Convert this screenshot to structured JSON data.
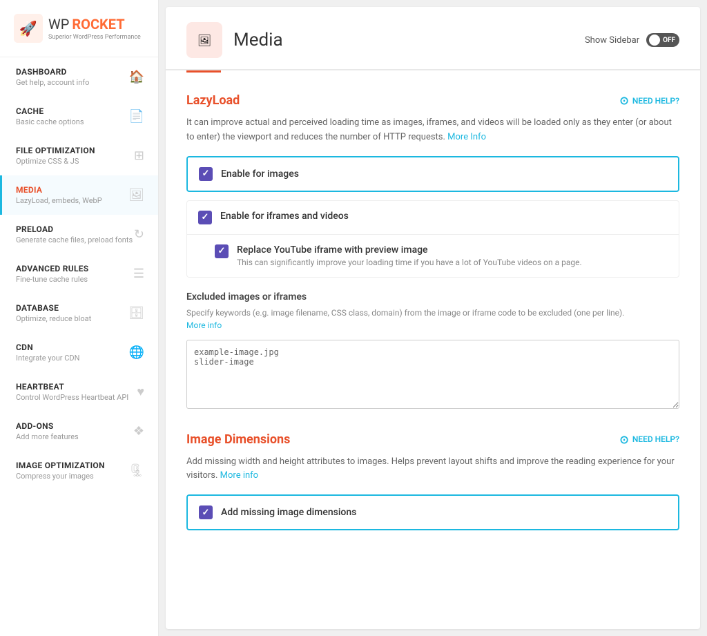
{
  "logo": {
    "wp": "WP",
    "rocket": "ROCKET",
    "subtitle": "Superior WordPress Performance"
  },
  "nav": {
    "items": [
      {
        "id": "dashboard",
        "title": "DASHBOARD",
        "subtitle": "Get help, account info",
        "icon": "🏠",
        "active": false
      },
      {
        "id": "cache",
        "title": "CACHE",
        "subtitle": "Basic cache options",
        "icon": "📄",
        "active": false
      },
      {
        "id": "file-optimization",
        "title": "FILE OPTIMIZATION",
        "subtitle": "Optimize CSS & JS",
        "icon": "⊞",
        "active": false
      },
      {
        "id": "media",
        "title": "MEDIA",
        "subtitle": "LazyLoad, embeds, WebP",
        "icon": "🖼",
        "active": true
      },
      {
        "id": "preload",
        "title": "PRELOAD",
        "subtitle": "Generate cache files, preload fonts",
        "icon": "↻",
        "active": false
      },
      {
        "id": "advanced-rules",
        "title": "ADVANCED RULES",
        "subtitle": "Fine-tune cache rules",
        "icon": "☰",
        "active": false
      },
      {
        "id": "database",
        "title": "DATABASE",
        "subtitle": "Optimize, reduce bloat",
        "icon": "🗄",
        "active": false
      },
      {
        "id": "cdn",
        "title": "CDN",
        "subtitle": "Integrate your CDN",
        "icon": "🌐",
        "active": false
      },
      {
        "id": "heartbeat",
        "title": "HEARTBEAT",
        "subtitle": "Control WordPress Heartbeat API",
        "icon": "♥",
        "active": false
      },
      {
        "id": "add-ons",
        "title": "ADD-ONS",
        "subtitle": "Add more features",
        "icon": "❖",
        "active": false
      },
      {
        "id": "image-optimization",
        "title": "IMAGE OPTIMIZATION",
        "subtitle": "Compress your images",
        "icon": "🗜",
        "active": false
      }
    ]
  },
  "page": {
    "title": "Media",
    "show_sidebar_label": "Show Sidebar",
    "toggle_label": "OFF"
  },
  "lazyload": {
    "section_title": "LazyLoad",
    "need_help": "NEED HELP?",
    "description": "It can improve actual and perceived loading time as images, iframes, and videos will be loaded only as they enter (or about to enter) the viewport and reduces the number of HTTP requests.",
    "more_info_link": "More Info",
    "enable_images_label": "Enable for images",
    "enable_iframes_label": "Enable for iframes and videos",
    "replace_youtube_label": "Replace YouTube iframe with preview image",
    "replace_youtube_sub": "This can significantly improve your loading time if you have a lot of YouTube videos on a page.",
    "excluded_title": "Excluded images or iframes",
    "excluded_desc": "Specify keywords (e.g. image filename, CSS class, domain) from the image or iframe code to be excluded (one per line).",
    "excluded_more_info": "More info",
    "excluded_placeholder": "example-image.jpg\nslider-image"
  },
  "image_dimensions": {
    "section_title": "Image Dimensions",
    "need_help": "NEED HELP?",
    "description": "Add missing width and height attributes to images. Helps prevent layout shifts and improve the reading experience for your visitors.",
    "more_info_link": "More info",
    "add_missing_label": "Add missing image dimensions"
  }
}
